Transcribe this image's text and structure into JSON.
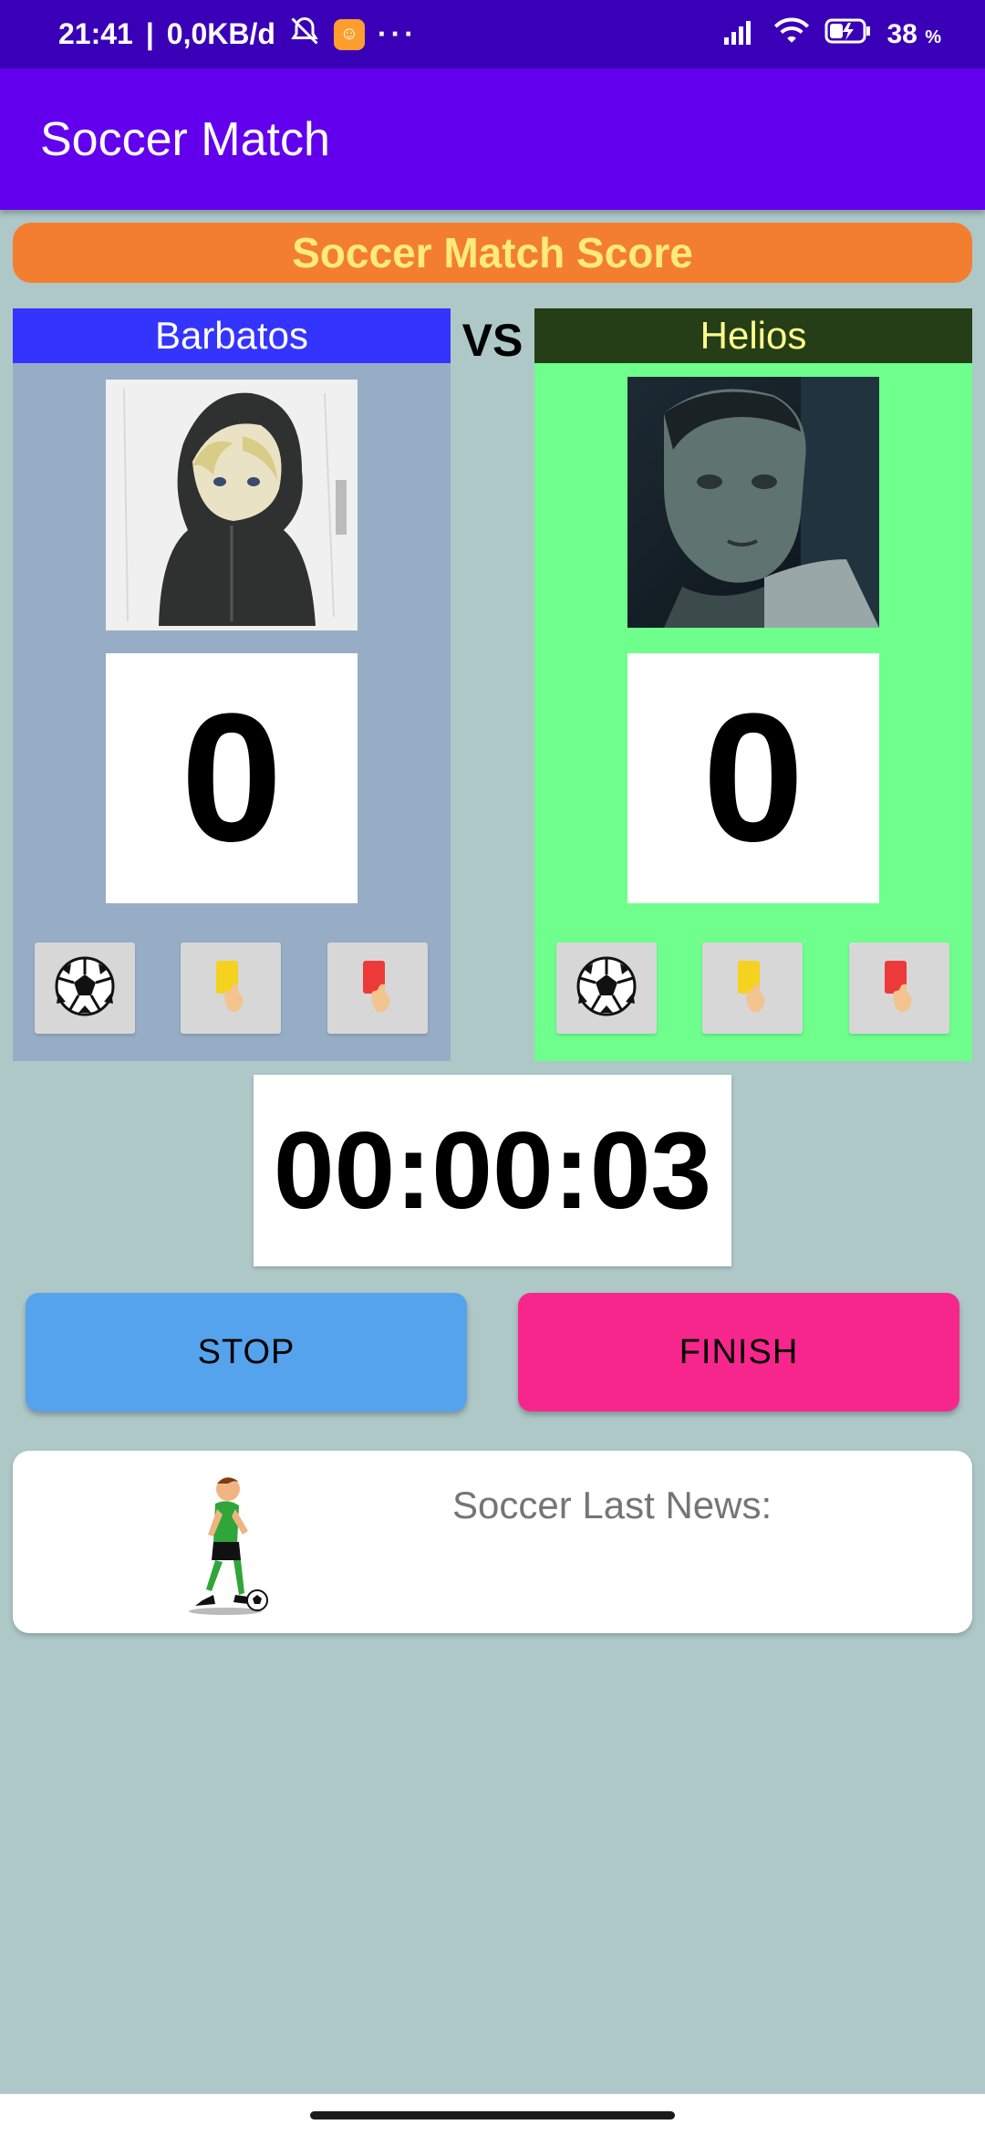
{
  "status_bar": {
    "time": "21:41",
    "network_speed": "0,0KB/d",
    "battery_percent": "38",
    "battery_unit": "%",
    "icons": [
      "mute-alarm-icon",
      "app-notification-icon",
      "more-dots-icon",
      "signal-icon",
      "wifi-icon",
      "battery-charging-icon"
    ]
  },
  "app_bar": {
    "title": "Soccer Match"
  },
  "banner": {
    "title": "Soccer Match Score"
  },
  "vs_label": "VS",
  "team_a": {
    "name": "Barbatos",
    "score": "0",
    "avatar": "hooded-anime-character-avatar",
    "color": "#3434ff",
    "panel_color": "#97adc6"
  },
  "team_b": {
    "name": "Helios",
    "score": "0",
    "avatar": "man-portrait-avatar",
    "color": "#253e17",
    "panel_color": "#6fff8d"
  },
  "action_buttons": [
    "soccer-ball-icon",
    "yellow-card-icon",
    "red-card-icon"
  ],
  "timer": "00:00:03",
  "controls": {
    "stop_label": "STOP",
    "finish_label": "FINISH"
  },
  "news": {
    "label": "Soccer Last News:",
    "icon": "soccer-player-icon"
  }
}
